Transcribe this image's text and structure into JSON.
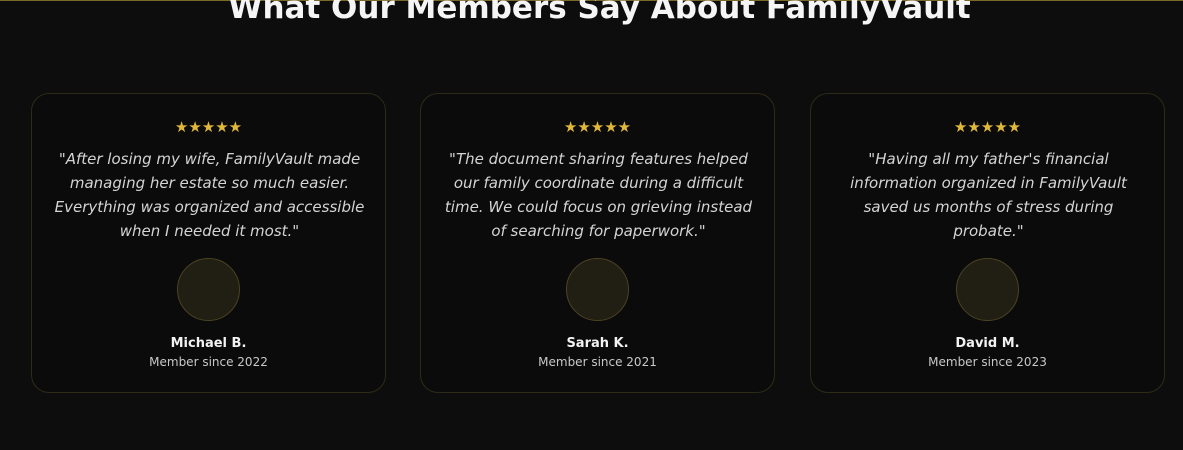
{
  "section": {
    "title": "What Our Members Say About FamilyVault"
  },
  "colors": {
    "background": "#0d0d0d",
    "accent_gold": "#e0b83c",
    "card_border": "#2e2a18"
  },
  "testimonials": [
    {
      "rating": 5,
      "stars": "★★★★★",
      "quote": "\"After losing my wife, FamilyVault made managing her estate so much easier. Everything was organized and accessible when I needed it most.\"",
      "name": "Michael B.",
      "member_since": "Member since 2022"
    },
    {
      "rating": 5,
      "stars": "★★★★★",
      "quote": "\"The document sharing features helped our family coordinate during a difficult time. We could focus on grieving instead of searching for paperwork.\"",
      "name": "Sarah K.",
      "member_since": "Member since 2021"
    },
    {
      "rating": 5,
      "stars": "★★★★★",
      "quote": "\"Having all my father's financial information organized in FamilyVault saved us months of stress during probate.\"",
      "name": "David M.",
      "member_since": "Member since 2023"
    }
  ]
}
